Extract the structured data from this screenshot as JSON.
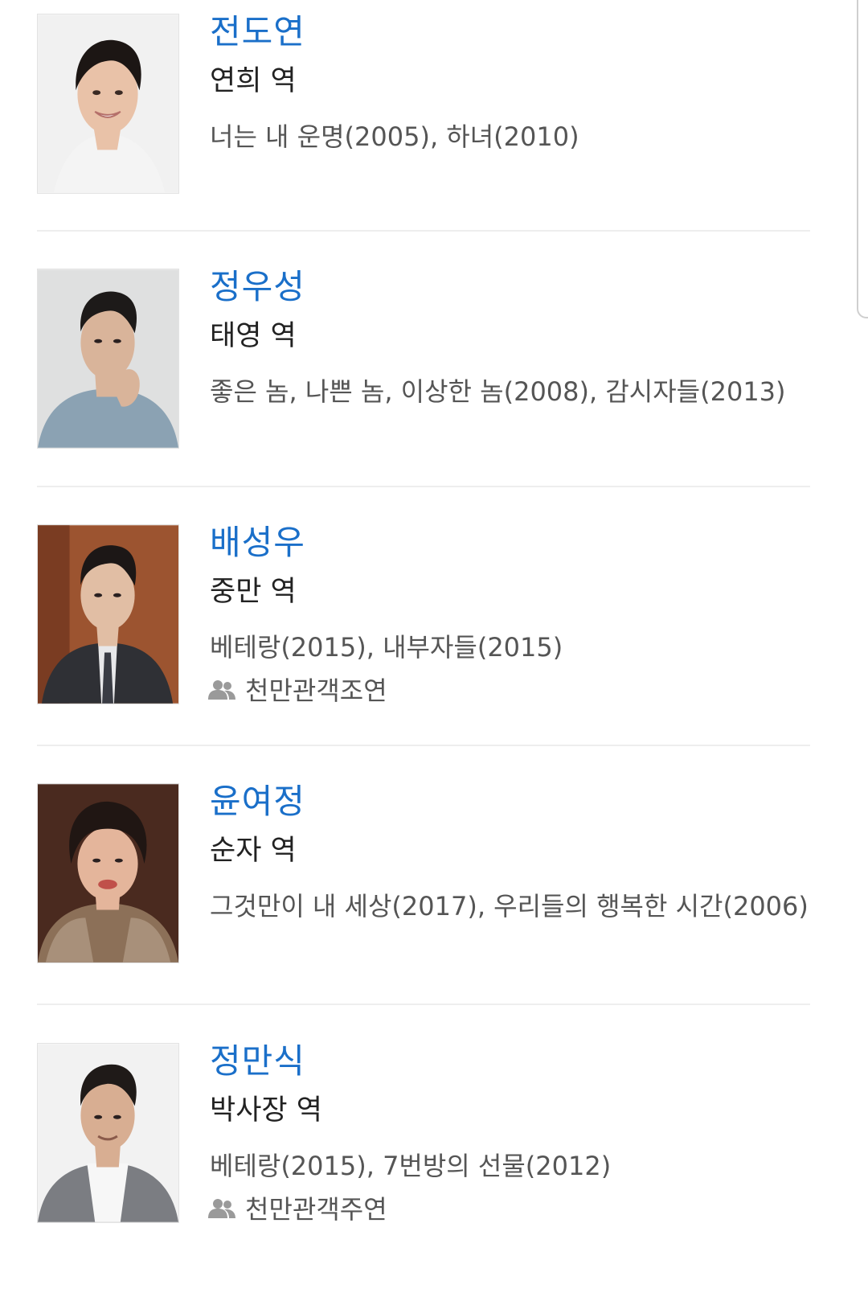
{
  "cast": [
    {
      "name": "전도연",
      "role": "연희 역",
      "works": "너는 내 운명(2005), 하녀(2010)",
      "badge": null,
      "photo": {
        "background": "#f1f1f1",
        "hair": "#1c1614",
        "skin": "#e9c2a8",
        "clothing": "#f4f4f4"
      }
    },
    {
      "name": "정우성",
      "role": "태영 역",
      "works": "좋은 놈, 나쁜 놈, 이상한 놈(2008), 감시자들(2013)",
      "badge": null,
      "photo": {
        "background": "#dfe0e0",
        "hair": "#1d1a19",
        "skin": "#d9b49a",
        "clothing": "#8ba2b3"
      }
    },
    {
      "name": "배성우",
      "role": "중만 역",
      "works": "베테랑(2015), 내부자들(2015)",
      "badge": "천만관객조연",
      "photo": {
        "background": "#9c5430",
        "hair": "#1c1716",
        "skin": "#e1bea4",
        "clothing": "#2f3035"
      }
    },
    {
      "name": "윤여정",
      "role": "순자 역",
      "works": "그것만이 내 세상(2017), 우리들의 행복한 시간(2006)",
      "badge": null,
      "photo": {
        "background": "#4a2a1f",
        "hair": "#201613",
        "skin": "#e4b59b",
        "clothing": "#8c7058"
      }
    },
    {
      "name": "정만식",
      "role": "박사장 역",
      "works": "베테랑(2015), 7번방의 선물(2012)",
      "badge": "천만관객주연",
      "photo": {
        "background": "#f2f2f2",
        "hair": "#1f1a18",
        "skin": "#d8ae92",
        "clothing": "#7b7d82"
      }
    }
  ],
  "icons": {
    "badge": "people-icon"
  },
  "colors": {
    "name": "#1a6fc9",
    "role": "#222222",
    "works": "#555555",
    "divider": "#eeeeee",
    "badge_icon": "#9a9a9a"
  }
}
